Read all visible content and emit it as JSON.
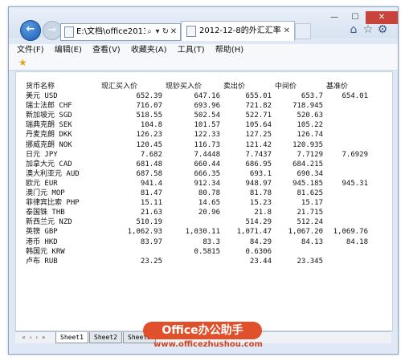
{
  "browser": {
    "address": "E:\\文档\\office2013\\",
    "address_controls": [
      "⌕",
      "▾",
      "↻",
      "✕"
    ],
    "tab_title": "2012-12-8的外汇汇率",
    "menu": [
      "文件(F)",
      "编辑(E)",
      "查看(V)",
      "收藏夹(A)",
      "工具(T)",
      "帮助(H)"
    ]
  },
  "table": {
    "headers": [
      "货币名称",
      "现汇买入价",
      "现钞买入价",
      "卖出价",
      "中间价",
      "基准价"
    ],
    "rows": [
      [
        "美元 USD",
        "652.39",
        "647.16",
        "655.01",
        "653.7",
        "654.01"
      ],
      [
        "瑞士法郎 CHF",
        "716.07",
        "693.96",
        "721.82",
        "718.945",
        ""
      ],
      [
        "新加坡元 SGD",
        "518.55",
        "502.54",
        "522.71",
        "520.63",
        ""
      ],
      [
        "瑞典克朗 SEK",
        "104.8",
        "101.57",
        "105.64",
        "105.22",
        ""
      ],
      [
        "丹麦克朗 DKK",
        "126.23",
        "122.33",
        "127.25",
        "126.74",
        ""
      ],
      [
        "挪威克朗 NOK",
        "120.45",
        "116.73",
        "121.42",
        "120.935",
        ""
      ],
      [
        "日元 JPY",
        "7.682",
        "7.4448",
        "7.7437",
        "7.7129",
        "7.6929"
      ],
      [
        "加拿大元 CAD",
        "681.48",
        "660.44",
        "686.95",
        "684.215",
        ""
      ],
      [
        "澳大利亚元 AUD",
        "687.58",
        "666.35",
        "693.1",
        "690.34",
        ""
      ],
      [
        "欧元 EUR",
        "941.4",
        "912.34",
        "948.97",
        "945.185",
        "945.31"
      ],
      [
        "澳门元 MOP",
        "81.47",
        "80.78",
        "81.78",
        "81.625",
        ""
      ],
      [
        "菲律宾比索 PHP",
        "15.11",
        "14.65",
        "15.23",
        "15.17",
        ""
      ],
      [
        "泰国铢 THB",
        "21.63",
        "20.96",
        "21.8",
        "21.715",
        ""
      ],
      [
        "新西兰元 NZD",
        "510.19",
        "",
        "514.29",
        "512.24",
        ""
      ],
      [
        "英镑 GBP",
        "1,062.93",
        "1,030.11",
        "1,071.47",
        "1,067.20",
        "1,069.76"
      ],
      [
        "港币 HKD",
        "83.97",
        "83.3",
        "84.29",
        "84.13",
        "84.18"
      ],
      [
        "韩国元 KRW",
        "",
        "0.5815",
        "0.6306",
        "",
        ""
      ],
      [
        "卢布 RUB",
        "23.25",
        "",
        "23.44",
        "23.345",
        ""
      ]
    ]
  },
  "sheets": {
    "nav": "« ‹ › »",
    "tabs": [
      "Sheet1",
      "Sheet2",
      "Sheet3"
    ],
    "active": "Sheet1"
  },
  "watermark": {
    "logo_text": "Office办公助手",
    "url": "www.officezhushou.com"
  }
}
